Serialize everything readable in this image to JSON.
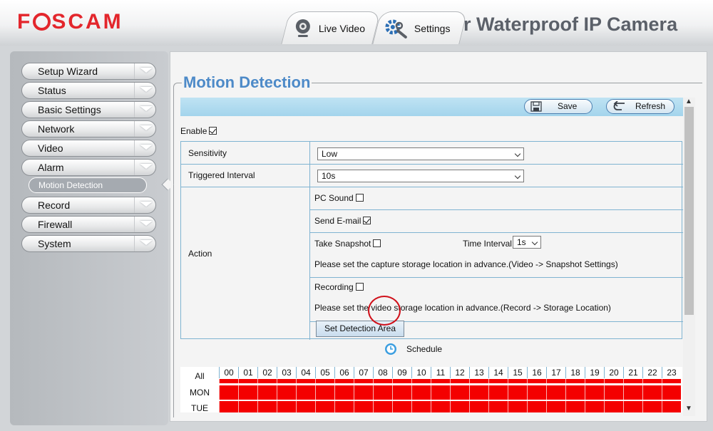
{
  "header": {
    "logo": "FOSCAM",
    "product_title": "r Waterproof IP Camera",
    "tabs": [
      {
        "label": "Live Video",
        "icon": "webcam-icon"
      },
      {
        "label": "Settings",
        "icon": "gear-wrench-icon"
      }
    ]
  },
  "sidebar": {
    "items": [
      {
        "label": "Setup Wizard"
      },
      {
        "label": "Status"
      },
      {
        "label": "Basic Settings"
      },
      {
        "label": "Network"
      },
      {
        "label": "Video"
      },
      {
        "label": "Alarm"
      },
      {
        "label": "Record"
      },
      {
        "label": "Firewall"
      },
      {
        "label": "System"
      }
    ],
    "sub_item": "Motion Detection"
  },
  "main": {
    "title": "Motion Detection",
    "toolbar": {
      "save_label": "Save",
      "refresh_label": "Refresh"
    },
    "enable_label": "Enable",
    "enable_checked": true,
    "sensitivity": {
      "label": "Sensitivity",
      "value": "Low"
    },
    "triggered_interval": {
      "label": "Triggered Interval",
      "value": "10s"
    },
    "action": {
      "label": "Action",
      "pc_sound": "PC Sound",
      "send_email": "Send E-mail",
      "take_snapshot": "Take Snapshot",
      "time_interval_label": "Time Interval",
      "time_interval_value": "1s",
      "snapshot_note": "Please set the capture storage location in advance.(Video -> Snapshot Settings)",
      "recording": "Recording",
      "recording_note": "Please set the video storage location in advance.(Record -> Storage Location)",
      "set_detection_area": "Set Detection Area"
    },
    "schedule": {
      "label": "Schedule",
      "all_label": "All",
      "hours": [
        "00",
        "01",
        "02",
        "03",
        "04",
        "05",
        "06",
        "07",
        "08",
        "09",
        "10",
        "11",
        "12",
        "13",
        "14",
        "15",
        "16",
        "17",
        "18",
        "19",
        "20",
        "21",
        "22",
        "23"
      ],
      "days": [
        "MON",
        "TUE"
      ]
    }
  },
  "colors": {
    "accent_blue": "#4d8ac8",
    "schedule_red": "#f40000",
    "annotation_red": "#d0101a",
    "logo_red": "#e3262c"
  }
}
